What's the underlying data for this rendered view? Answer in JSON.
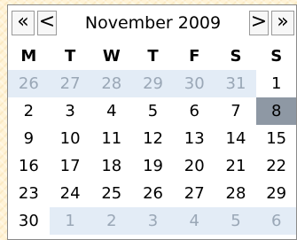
{
  "calendar": {
    "title": "November 2009",
    "nav": {
      "prev_year": "«",
      "prev_month": "<",
      "next_month": ">",
      "next_year": "»"
    },
    "weekdays": [
      "M",
      "T",
      "W",
      "T",
      "F",
      "S",
      "S"
    ],
    "weeks": [
      [
        "26",
        "27",
        "28",
        "29",
        "30",
        "31",
        "1"
      ],
      [
        "2",
        "3",
        "4",
        "5",
        "6",
        "7",
        "8"
      ],
      [
        "9",
        "10",
        "11",
        "12",
        "13",
        "14",
        "15"
      ],
      [
        "16",
        "17",
        "18",
        "19",
        "20",
        "21",
        "22"
      ],
      [
        "23",
        "24",
        "25",
        "26",
        "27",
        "28",
        "29"
      ],
      [
        "30",
        "1",
        "2",
        "3",
        "4",
        "5",
        "6"
      ]
    ],
    "other_month_days": {
      "week_0": [
        0,
        1,
        2,
        3,
        4,
        5
      ],
      "week_5": [
        1,
        2,
        3,
        4,
        5,
        6
      ]
    },
    "selected": {
      "week": 1,
      "day_index": 6
    },
    "colors": {
      "other_month_text": "#9aa7b6",
      "other_month_bg": "#e3ecf6",
      "selected_bg": "#8e98a4"
    }
  }
}
